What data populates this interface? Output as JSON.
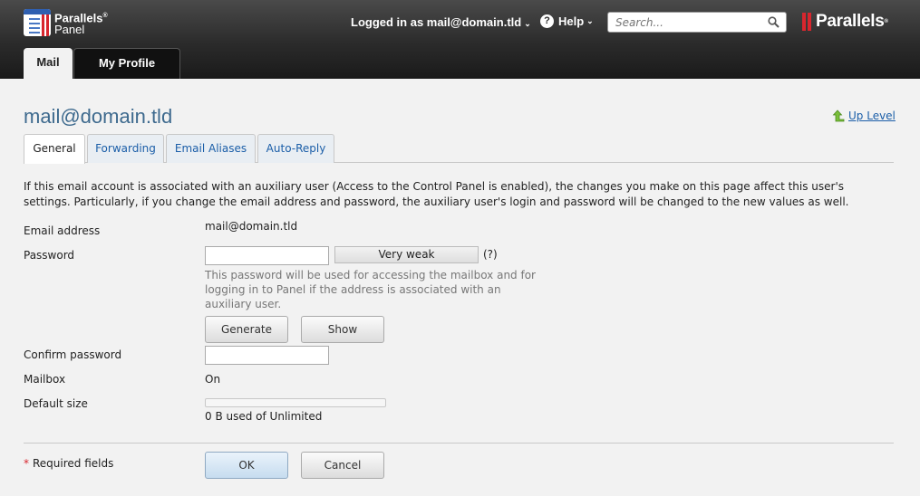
{
  "header": {
    "logo_line1": "Parallels",
    "logo_reg": "®",
    "logo_line2": "Panel",
    "login_prefix": "Logged in as",
    "login_user": "mail@domain.tld",
    "help_label": "Help",
    "search_placeholder": "Search...",
    "brand": "Parallels",
    "brand_reg": "®"
  },
  "top_tabs": [
    {
      "label": "Mail",
      "active": true
    },
    {
      "label": "My Profile",
      "active": false
    }
  ],
  "page": {
    "title": "mail@domain.tld",
    "up_level": "Up Level"
  },
  "tabs": [
    {
      "label": "General",
      "active": true
    },
    {
      "label": "Forwarding",
      "active": false
    },
    {
      "label": "Email Aliases",
      "active": false
    },
    {
      "label": "Auto-Reply",
      "active": false
    }
  ],
  "notice": "If this email account is associated with an auxiliary user (Access to the Control Panel is enabled), the changes you make on this page affect this user's settings. Particularly, if you change the email address and password, the auxiliary user's login and password will be changed to the new values as well.",
  "form": {
    "email_label": "Email address",
    "email_value": "mail@domain.tld",
    "password_label": "Password",
    "password_value": "",
    "strength": "Very weak",
    "strength_help": "(?)",
    "password_hint": "This password will be used for accessing the mailbox and for logging in to Panel if the address is associated with an auxiliary user.",
    "generate_button": "Generate",
    "show_button": "Show",
    "confirm_label": "Confirm password",
    "confirm_value": "",
    "mailbox_label": "Mailbox",
    "mailbox_value": "On",
    "default_size_label": "Default size",
    "usage_fraction": 0,
    "usage_text": "0 B used of Unlimited"
  },
  "footer": {
    "required_star": "*",
    "required_label": "Required fields",
    "ok_button": "OK",
    "cancel_button": "Cancel"
  },
  "colors": {
    "title": "#3e6a8e",
    "link": "#1b5ea8",
    "brand_red": "#d8262e"
  }
}
